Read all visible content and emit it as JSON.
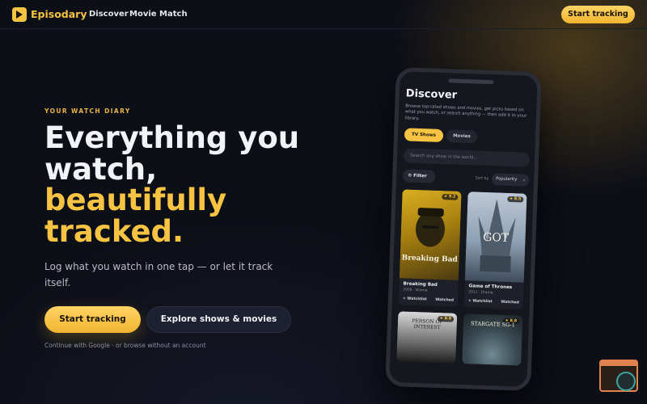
{
  "nav": {
    "brand": "Episodary",
    "links": [
      "Discover",
      "Movie Match"
    ],
    "cta": "Start tracking"
  },
  "hero": {
    "eyebrow": "YOUR WATCH DIARY",
    "headline_white_1": "Everything you",
    "headline_white_2": "watch,",
    "headline_yellow_1": "beautifully",
    "headline_yellow_2": "tracked.",
    "subtitle": "Log what you watch in one tap — or let it track itself.",
    "primary_button": "Start tracking",
    "secondary_button": "Explore shows & movies",
    "fine_print": "Continue with Google · or browse without an account"
  },
  "phone": {
    "title": "Discover",
    "description": "Browse top-rated shows and movies, get picks based on what you watch, or search anything — then add it to your library.",
    "tabs": [
      "TV Shows",
      "Movies"
    ],
    "search_placeholder": "Search any show in the world...",
    "filter_label": "Filter",
    "sort_label": "Sort by",
    "sort_value": "Popularity",
    "cards": [
      {
        "title": "Breaking Bad",
        "meta": "2008 · Drama",
        "rating": "9.2",
        "poster_text": "Breaking Bad",
        "watchlist": "+ Watchlist",
        "watched": "Watched"
      },
      {
        "title": "Game of Thrones",
        "meta": "2011 · Drama",
        "rating": "8.5",
        "poster_text": "GOT",
        "watchlist": "+ Watchlist",
        "watched": "Watched"
      },
      {
        "title": "",
        "meta": "",
        "rating": "8.8",
        "poster_text": "PERSON OF INTEREST"
      },
      {
        "title": "",
        "meta": "",
        "rating": "8.8",
        "poster_text": "STARGATE SG-1"
      }
    ]
  },
  "colors": {
    "accent": "#f6c343",
    "background": "#0b0d14",
    "button_dark": "#1d2030"
  }
}
